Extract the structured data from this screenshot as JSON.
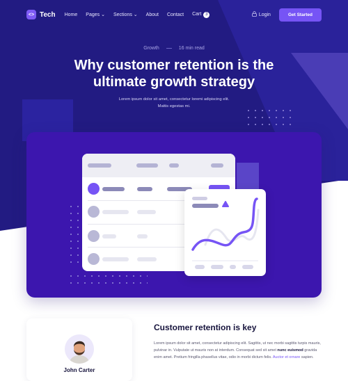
{
  "nav": {
    "brand": "Tech",
    "items": [
      "Home",
      "Pages",
      "Sections",
      "About",
      "Contact",
      "Cart"
    ],
    "cart_count": "3",
    "login": "Login",
    "cta": "Get Started"
  },
  "hero": {
    "category": "Growth",
    "read_time": "16 min read",
    "title": "Why customer retention is the ultimate growth strategy",
    "subtitle_line1": "Lorem ipsum dolor sit amet, consectetur loremi adipiscing elit.",
    "subtitle_line2": "Mattis egestas mi."
  },
  "author": {
    "name": "John Carter"
  },
  "article": {
    "heading": "Customer retention is key",
    "p1": "Lorem ipsum dolor sit amet, consectetur adipiscing elit. Sagittis, ut nec morbi sagittis turpis mauris, pulvinar in. Vulputate ut mauris non at interdum. Consequat sed sit amet ",
    "bold": "nunc euismod",
    "p2": " gravida enim amet. Pretium fringilla phasellus vitae, odio in morbi dictum felis. ",
    "link": "Auctor et ornare",
    "p3": " sapien."
  },
  "colors": {
    "hero": "#221b82",
    "accent": "#7654f5",
    "card": "#3c16ae"
  }
}
